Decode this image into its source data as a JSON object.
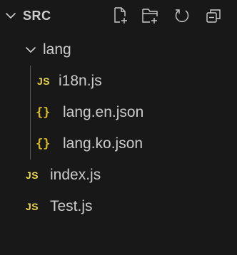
{
  "explorer": {
    "header": {
      "folder_name": "SRC",
      "chevron_icon": "chevron-down-icon",
      "actions": [
        {
          "name": "new-file-button",
          "icon": "new-file-icon"
        },
        {
          "name": "new-folder-button",
          "icon": "new-folder-icon"
        },
        {
          "name": "refresh-button",
          "icon": "refresh-icon"
        },
        {
          "name": "collapse-all-button",
          "icon": "collapse-all-icon"
        }
      ]
    },
    "tree": {
      "folder_lang": {
        "label": "lang",
        "icon": "chevron-down-icon"
      },
      "file_i18n": {
        "label": "i18n.js",
        "badge": "JS"
      },
      "file_lang_en": {
        "label": "lang.en.json",
        "badge": "{}"
      },
      "file_lang_ko": {
        "label": "lang.ko.json",
        "badge": "{}"
      },
      "file_index": {
        "label": "index.js",
        "badge": "JS"
      },
      "file_test": {
        "label": "Test.js",
        "badge": "JS"
      }
    },
    "colors": {
      "background": "#181818",
      "text": "#cccccc",
      "js_badge": "#e8d44d",
      "json_badge": "#d7ba23",
      "indent_guide": "#555555"
    }
  }
}
